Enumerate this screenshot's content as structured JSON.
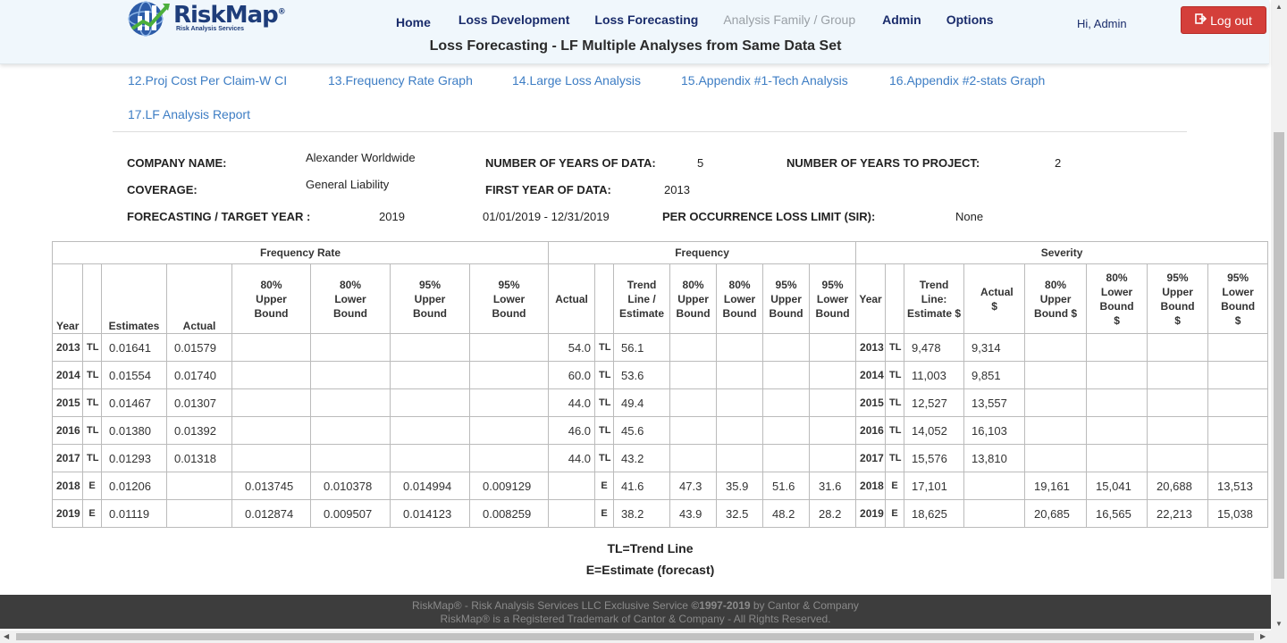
{
  "header": {
    "logo_text": "RiskMap",
    "logo_reg": "®",
    "logo_sub": "Risk Analysis Services",
    "nav": [
      "Home",
      "Loss Development",
      "Loss Forecasting",
      "Analysis Family / Group",
      "Admin",
      "Options"
    ],
    "greeting": "Hi, Admin",
    "logout_label": "Log out",
    "page_subtitle": "Loss Forecasting - LF Multiple Analyses from Same Data Set"
  },
  "report_links": [
    "12.Proj Cost Per Claim-W CI",
    "13.Frequency Rate Graph",
    "14.Large Loss Analysis",
    "15.Appendix #1-Tech Analysis",
    "16.Appendix #2-stats Graph",
    "17.LF Analysis Report"
  ],
  "info": {
    "company_label": "COMPANY NAME:",
    "company_value": "Alexander Worldwide",
    "coverage_label": "COVERAGE:",
    "coverage_value": "General Liability",
    "target_label": "FORECASTING / TARGET YEAR :",
    "target_value": "2019",
    "target_range": "01/01/2019 - 12/31/2019",
    "years_data_label": "NUMBER OF YEARS OF DATA:",
    "years_data_value": "5",
    "first_year_label": "FIRST YEAR OF DATA:",
    "first_year_value": "2013",
    "sir_label": "PER OCCURRENCE LOSS LIMIT (SIR):",
    "sir_value": "None",
    "years_project_label": "NUMBER OF YEARS TO PROJECT:",
    "years_project_value": "2"
  },
  "table": {
    "groups": [
      "Frequency Rate",
      "Frequency",
      "Severity"
    ],
    "headers": {
      "year": "Year",
      "estimates": "Estimates",
      "actual": "Actual",
      "u80": "80% Upper Bound",
      "l80": "80% Lower Bound",
      "u95": "95% Upper Bound",
      "l95": "95% Lower Bound",
      "trend_est": "Trend Line / Estimate",
      "sev_trend": "Trend Line: Estimate $",
      "sev_actual": "Actual $",
      "u80s": "80% Upper Bound $",
      "l80s": "80% Lower Bound $",
      "u95s": "95% Upper Bound $",
      "l95s": "95% Lower Bound $"
    },
    "rows": [
      {
        "year": "2013",
        "tag": "TL",
        "fr_est": "0.01641",
        "fr_act": "0.01579",
        "fr_u80": "",
        "fr_l80": "",
        "fr_u95": "",
        "fr_l95": "",
        "f_act": "54.0",
        "f_tag": "TL",
        "f_trend": "56.1",
        "f_u80": "",
        "f_l80": "",
        "f_u95": "",
        "f_l95": "",
        "s_year": "2013",
        "s_tag": "TL",
        "s_trend": "9,478",
        "s_act": "9,314",
        "s_u80": "",
        "s_l80": "",
        "s_u95": "",
        "s_l95": ""
      },
      {
        "year": "2014",
        "tag": "TL",
        "fr_est": "0.01554",
        "fr_act": "0.01740",
        "fr_u80": "",
        "fr_l80": "",
        "fr_u95": "",
        "fr_l95": "",
        "f_act": "60.0",
        "f_tag": "TL",
        "f_trend": "53.6",
        "f_u80": "",
        "f_l80": "",
        "f_u95": "",
        "f_l95": "",
        "s_year": "2014",
        "s_tag": "TL",
        "s_trend": "11,003",
        "s_act": "9,851",
        "s_u80": "",
        "s_l80": "",
        "s_u95": "",
        "s_l95": ""
      },
      {
        "year": "2015",
        "tag": "TL",
        "fr_est": "0.01467",
        "fr_act": "0.01307",
        "fr_u80": "",
        "fr_l80": "",
        "fr_u95": "",
        "fr_l95": "",
        "f_act": "44.0",
        "f_tag": "TL",
        "f_trend": "49.4",
        "f_u80": "",
        "f_l80": "",
        "f_u95": "",
        "f_l95": "",
        "s_year": "2015",
        "s_tag": "TL",
        "s_trend": "12,527",
        "s_act": "13,557",
        "s_u80": "",
        "s_l80": "",
        "s_u95": "",
        "s_l95": ""
      },
      {
        "year": "2016",
        "tag": "TL",
        "fr_est": "0.01380",
        "fr_act": "0.01392",
        "fr_u80": "",
        "fr_l80": "",
        "fr_u95": "",
        "fr_l95": "",
        "f_act": "46.0",
        "f_tag": "TL",
        "f_trend": "45.6",
        "f_u80": "",
        "f_l80": "",
        "f_u95": "",
        "f_l95": "",
        "s_year": "2016",
        "s_tag": "TL",
        "s_trend": "14,052",
        "s_act": "16,103",
        "s_u80": "",
        "s_l80": "",
        "s_u95": "",
        "s_l95": ""
      },
      {
        "year": "2017",
        "tag": "TL",
        "fr_est": "0.01293",
        "fr_act": "0.01318",
        "fr_u80": "",
        "fr_l80": "",
        "fr_u95": "",
        "fr_l95": "",
        "f_act": "44.0",
        "f_tag": "TL",
        "f_trend": "43.2",
        "f_u80": "",
        "f_l80": "",
        "f_u95": "",
        "f_l95": "",
        "s_year": "2017",
        "s_tag": "TL",
        "s_trend": "15,576",
        "s_act": "13,810",
        "s_u80": "",
        "s_l80": "",
        "s_u95": "",
        "s_l95": ""
      },
      {
        "year": "2018",
        "tag": "E",
        "fr_est": "0.01206",
        "fr_act": "",
        "fr_u80": "0.013745",
        "fr_l80": "0.010378",
        "fr_u95": "0.014994",
        "fr_l95": "0.009129",
        "f_act": "",
        "f_tag": "E",
        "f_trend": "41.6",
        "f_u80": "47.3",
        "f_l80": "35.9",
        "f_u95": "51.6",
        "f_l95": "31.6",
        "s_year": "2018",
        "s_tag": "E",
        "s_trend": "17,101",
        "s_act": "",
        "s_u80": "19,161",
        "s_l80": "15,041",
        "s_u95": "20,688",
        "s_l95": "13,513"
      },
      {
        "year": "2019",
        "tag": "E",
        "fr_est": "0.01119",
        "fr_act": "",
        "fr_u80": "0.012874",
        "fr_l80": "0.009507",
        "fr_u95": "0.014123",
        "fr_l95": "0.008259",
        "f_act": "",
        "f_tag": "E",
        "f_trend": "38.2",
        "f_u80": "43.9",
        "f_l80": "32.5",
        "f_u95": "48.2",
        "f_l95": "28.2",
        "s_year": "2019",
        "s_tag": "E",
        "s_trend": "18,625",
        "s_act": "",
        "s_u80": "20,685",
        "s_l80": "16,565",
        "s_u95": "22,213",
        "s_l95": "15,038"
      }
    ]
  },
  "legend": {
    "tl": "TL=Trend Line",
    "e": "E=Estimate (forecast)"
  },
  "footer": {
    "line1_a": "RiskMap® - Risk Analysis Services LLC Exclusive Service ",
    "line1_b": "©1997-2019",
    "line1_c": " by Cantor & Company",
    "line2": "RiskMap® is a Registered Trademark of Cantor & Company - All Rights Reserved."
  },
  "colors": {
    "header_bg": "#f0f7fc",
    "nav_text": "#1a2c6b",
    "link": "#3d7dc4",
    "logout_bg": "#d43f3a",
    "footer_bg": "#3d3d3d"
  }
}
